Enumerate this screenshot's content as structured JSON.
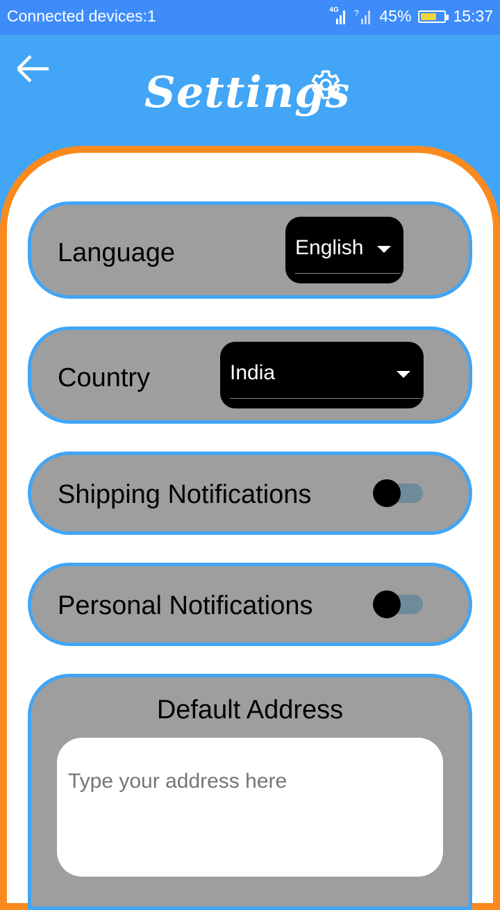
{
  "status_bar": {
    "left_text": "Connected devices:1",
    "network": "4G",
    "battery": "45%",
    "battery_level": 0.45,
    "time": "15:37"
  },
  "app_bar": {
    "title": "Settings",
    "back_icon": "arrow-left-icon",
    "settings_icon": "gear-icon"
  },
  "settings": {
    "language": {
      "label": "Language",
      "selected": "English"
    },
    "country": {
      "label": "Country",
      "selected": "India"
    },
    "shipping_notifications": {
      "label": "Shipping Notifications",
      "enabled": false
    },
    "personal_notifications": {
      "label": "Personal Notifications",
      "enabled": false
    }
  },
  "address": {
    "title": "Default Address",
    "value": "",
    "placeholder": "Type your address here"
  },
  "colors": {
    "app_bar": "#42a5f5",
    "status_bar": "#3d8cfa",
    "card_border": "#fb8a1e",
    "row_background": "#9e9e9e",
    "row_border": "#42a5f5",
    "dropdown_background": "#000000"
  }
}
